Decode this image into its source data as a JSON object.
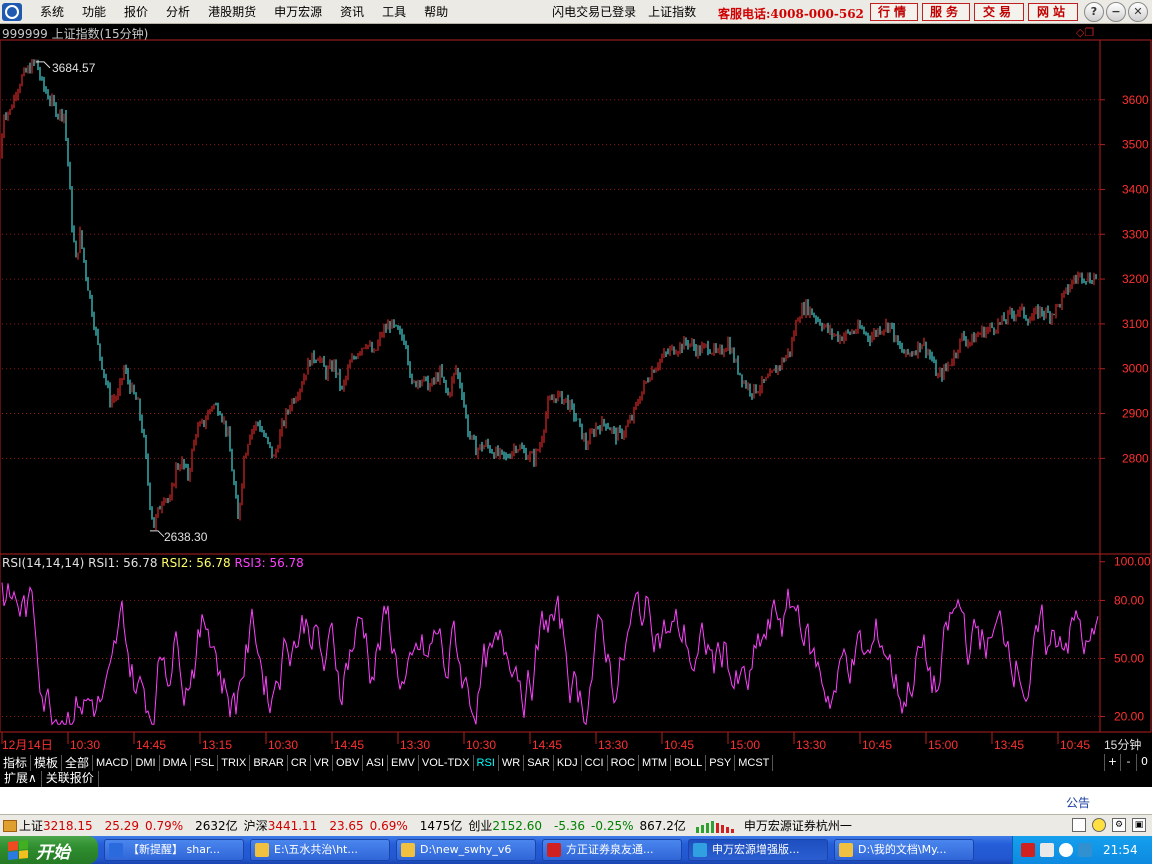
{
  "menubar": {
    "items": [
      "系统",
      "功能",
      "报价",
      "分析",
      "港股期货",
      "申万宏源",
      "资讯",
      "工具",
      "帮助"
    ],
    "status1": "闪电交易已登录",
    "status2": "上证指数",
    "hotline": "客服电话:4008-000-562",
    "buttons": [
      "行情",
      "服务",
      "交易",
      "网站"
    ],
    "window_controls": [
      "?",
      "−",
      "❐",
      "✕"
    ]
  },
  "chart_data": [
    {
      "type": "candlestick",
      "title": "999999 上证指数(15分钟)",
      "yticks": [
        2800,
        2900,
        3000,
        3100,
        3200,
        3300,
        3400,
        3500,
        3600
      ],
      "ylim": [
        2600,
        3720
      ],
      "high_label": "3684.57",
      "low_label": "2638.30",
      "colors": {
        "up": "#ff3030",
        "down": "#54ffff",
        "grid": "#8a1a1a",
        "axis": "#b02020"
      },
      "path": [
        [
          0,
          3470
        ],
        [
          4,
          3570
        ],
        [
          10,
          3575
        ],
        [
          16,
          3620
        ],
        [
          22,
          3650
        ],
        [
          30,
          3672
        ],
        [
          36,
          3684.57
        ],
        [
          42,
          3635
        ],
        [
          50,
          3600
        ],
        [
          58,
          3570
        ],
        [
          64,
          3570
        ],
        [
          68,
          3460
        ],
        [
          72,
          3320
        ],
        [
          76,
          3240
        ],
        [
          80,
          3300
        ],
        [
          86,
          3210
        ],
        [
          92,
          3130
        ],
        [
          98,
          3050
        ],
        [
          104,
          2990
        ],
        [
          110,
          2930
        ],
        [
          118,
          2940
        ],
        [
          124,
          3000
        ],
        [
          130,
          2960
        ],
        [
          138,
          2920
        ],
        [
          144,
          2840
        ],
        [
          150,
          2700
        ],
        [
          154,
          2650
        ],
        [
          158,
          2680
        ],
        [
          164,
          2720
        ],
        [
          170,
          2700
        ],
        [
          176,
          2780
        ],
        [
          182,
          2790
        ],
        [
          188,
          2760
        ],
        [
          196,
          2860
        ],
        [
          204,
          2880
        ],
        [
          212,
          2920
        ],
        [
          220,
          2910
        ],
        [
          228,
          2850
        ],
        [
          234,
          2740
        ],
        [
          238,
          2660
        ],
        [
          244,
          2800
        ],
        [
          250,
          2860
        ],
        [
          258,
          2880
        ],
        [
          266,
          2840
        ],
        [
          274,
          2800
        ],
        [
          282,
          2870
        ],
        [
          290,
          2920
        ],
        [
          300,
          2960
        ],
        [
          310,
          3020
        ],
        [
          318,
          3030
        ],
        [
          326,
          2990
        ],
        [
          334,
          3010
        ],
        [
          342,
          2950
        ],
        [
          350,
          3010
        ],
        [
          358,
          3040
        ],
        [
          366,
          3060
        ],
        [
          374,
          3030
        ],
        [
          382,
          3080
        ],
        [
          390,
          3100
        ],
        [
          398,
          3080
        ],
        [
          406,
          3060
        ],
        [
          412,
          2960
        ],
        [
          420,
          2980
        ],
        [
          430,
          2960
        ],
        [
          440,
          2990
        ],
        [
          448,
          2940
        ],
        [
          456,
          3000
        ],
        [
          462,
          2950
        ],
        [
          468,
          2860
        ],
        [
          476,
          2820
        ],
        [
          486,
          2830
        ],
        [
          496,
          2810
        ],
        [
          506,
          2800
        ],
        [
          516,
          2830
        ],
        [
          526,
          2810
        ],
        [
          534,
          2800
        ],
        [
          540,
          2830
        ],
        [
          548,
          2920
        ],
        [
          556,
          2940
        ],
        [
          566,
          2930
        ],
        [
          576,
          2890
        ],
        [
          586,
          2830
        ],
        [
          596,
          2870
        ],
        [
          606,
          2880
        ],
        [
          616,
          2850
        ],
        [
          624,
          2860
        ],
        [
          632,
          2890
        ],
        [
          640,
          2940
        ],
        [
          650,
          2990
        ],
        [
          660,
          3020
        ],
        [
          670,
          3040
        ],
        [
          680,
          3050
        ],
        [
          688,
          3060
        ],
        [
          698,
          3040
        ],
        [
          708,
          3050
        ],
        [
          718,
          3030
        ],
        [
          728,
          3060
        ],
        [
          736,
          3010
        ],
        [
          744,
          2970
        ],
        [
          752,
          2950
        ],
        [
          760,
          2960
        ],
        [
          770,
          2980
        ],
        [
          780,
          3010
        ],
        [
          790,
          3040
        ],
        [
          798,
          3120
        ],
        [
          806,
          3140
        ],
        [
          814,
          3120
        ],
        [
          822,
          3100
        ],
        [
          830,
          3080
        ],
        [
          840,
          3070
        ],
        [
          850,
          3080
        ],
        [
          860,
          3090
        ],
        [
          870,
          3070
        ],
        [
          880,
          3090
        ],
        [
          890,
          3100
        ],
        [
          898,
          3050
        ],
        [
          906,
          3030
        ],
        [
          914,
          3040
        ],
        [
          922,
          3060
        ],
        [
          930,
          3030
        ],
        [
          938,
          2980
        ],
        [
          946,
          3000
        ],
        [
          954,
          3030
        ],
        [
          962,
          3070
        ],
        [
          970,
          3060
        ],
        [
          980,
          3080
        ],
        [
          990,
          3090
        ],
        [
          1000,
          3100
        ],
        [
          1010,
          3120
        ],
        [
          1020,
          3130
        ],
        [
          1030,
          3110
        ],
        [
          1040,
          3130
        ],
        [
          1050,
          3120
        ],
        [
          1058,
          3140
        ],
        [
          1066,
          3170
        ],
        [
          1074,
          3200
        ],
        [
          1082,
          3210
        ],
        [
          1090,
          3200
        ],
        [
          1098,
          3210
        ]
      ]
    },
    {
      "type": "line",
      "title": "RSI(14,14,14)",
      "series": [
        {
          "name": "RSI1",
          "label": "RSI1: 56.78",
          "color": "#e0e0e0"
        },
        {
          "name": "RSI2",
          "label": "RSI2: 56.78",
          "color": "#ffff66"
        },
        {
          "name": "RSI3",
          "label": "RSI3: 56.78",
          "color": "#ff40ff"
        }
      ],
      "yticks": [
        "100.00",
        "80.00",
        "50.00",
        "20.00"
      ],
      "yvalues": [
        100,
        80,
        50,
        20
      ],
      "ylim": [
        12,
        104
      ]
    }
  ],
  "xaxis": {
    "labels": [
      "12月14日",
      "10:30",
      "14:45",
      "13:15",
      "10:30",
      "14:45",
      "13:30",
      "10:30",
      "14:45",
      "13:30",
      "10:45",
      "15:00",
      "13:30",
      "10:45",
      "15:00",
      "13:45",
      "10:45"
    ],
    "period": "15分钟"
  },
  "tabs": [
    "指标",
    "模板",
    "全部",
    "MACD",
    "DMI",
    "DMA",
    "FSL",
    "TRIX",
    "BRAR",
    "CR",
    "VR",
    "OBV",
    "ASI",
    "EMV",
    "VOL-TDX",
    "RSI",
    "WR",
    "SAR",
    "KDJ",
    "CCI",
    "ROC",
    "MTM",
    "BOLL",
    "PSY",
    "MCST"
  ],
  "active_tab": "RSI",
  "tab_controls": [
    "+",
    "-",
    "0"
  ],
  "ext_tabs": [
    "扩展∧",
    "关联报价"
  ],
  "notice": "公告",
  "statusbar": {
    "sh_label": "上证",
    "sh_value": "3218.15",
    "sh_change": "25.29",
    "sh_pct": "0.79%",
    "sh_amount": "2632亿",
    "hs_label": "沪深",
    "hs_value": "3441.11",
    "hs_change": "23.65",
    "hs_pct": "0.69%",
    "hs_amount": "1475亿",
    "cy_label": "创业",
    "cy_value": "2152.60",
    "cy_change": "-5.36",
    "cy_pct": "-0.25%",
    "cy_amount": "867.2亿",
    "broker": "申万宏源证券杭州一"
  },
  "taskbar": {
    "start": "开始",
    "tasks": [
      {
        "label": "【新提醒】 shar...",
        "icon_color": "#2a6adc"
      },
      {
        "label": "E:\\五水共治\\ht...",
        "icon_color": "#f0c040"
      },
      {
        "label": "D:\\new_swhy_v6",
        "icon_color": "#f0c040"
      },
      {
        "label": "方正证券泉友通...",
        "icon_color": "#d02020"
      },
      {
        "label": "申万宏源增强版...",
        "icon_color": "#30a0e0"
      },
      {
        "label": "D:\\我的文档\\My...",
        "icon_color": "#f0c040"
      }
    ],
    "active_task": 4,
    "clock": "21:54"
  }
}
